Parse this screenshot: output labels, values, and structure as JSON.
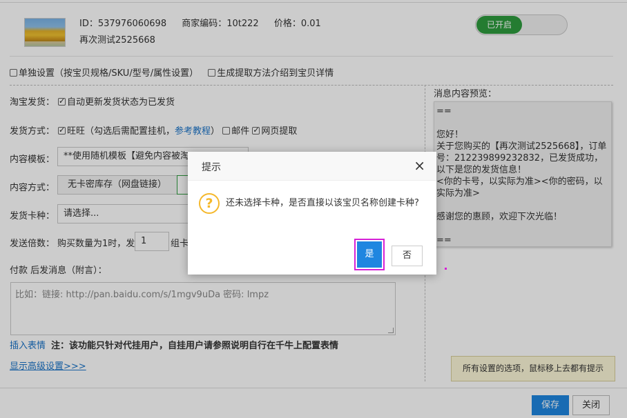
{
  "product": {
    "id_text": "ID：537976060698",
    "code_text": "商家编码：10t222",
    "price_text": "价格：0.01",
    "name": "再次测试2525668",
    "toggle_label": "已开启"
  },
  "options": {
    "individual_setting": "单独设置（按宝贝规格/SKU/型号/属性设置）",
    "gen_method": "生成提取方法介绍到宝贝详情"
  },
  "form": {
    "taobao_label": "淘宝发货：",
    "auto_update": "自动更新发货状态为已发货",
    "ship_method_label": "发货方式：",
    "wangwang": "旺旺（勾选后需配置挂机，",
    "ref_tutorial": "参考教程",
    "paren_close": "）",
    "mail": "邮件",
    "web_extract": "网页提取",
    "template_label": "内容模板：",
    "template_value": "**使用随机模板【避免内容被淘",
    "content_type_label": "内容方式：",
    "content_type_value": "无卡密库存（网盘链接）",
    "card_kind_label": "发货卡种：",
    "card_kind_value": "请选择...",
    "multiple_label": "发送倍数：",
    "multiple_text": "购买数量为1时，发",
    "multiple_value": "1",
    "multiple_suffix": "组卡",
    "after_pay_label": "付款 后发消息（附言）：",
    "textarea_placeholder": "比如：链接: http://pan.baidu.com/s/1mgv9uDa 密码: lmpz",
    "insert_emoji": "插入表情",
    "note_prefix": "注：该功能只针对代挂用户，自挂用户请",
    "note_link": "参照说明",
    "note_suffix": "自行在千牛上配置表情",
    "advanced": "显示高级设置>>>"
  },
  "preview": {
    "title": "消息内容预览：",
    "lines": [
      "==",
      "",
      "您好！",
      "关于您购买的【再次测试2525668】，订单号：212239899232832，已发货成功，以下是您的发货信息！",
      "<你的卡号，以实际为准><你的密码，以实际为准>",
      "",
      "感谢您的惠顾，欢迎下次光临！",
      "",
      "=="
    ]
  },
  "tip": "所有设置的选项，鼠标移上去都有提示",
  "footer": {
    "save": "保存",
    "close": "关闭"
  },
  "dialog": {
    "title": "提示",
    "close_symbol": "×",
    "icon": "?",
    "message": "还未选择卡种，是否直接以该宝贝名称创建卡种?",
    "yes": "是",
    "no": "否"
  },
  "colors": {
    "accent": "#1f86e0",
    "toggle_on": "#2e9b3e",
    "highlight": "#d620d6",
    "warning": "#f5b82b"
  }
}
